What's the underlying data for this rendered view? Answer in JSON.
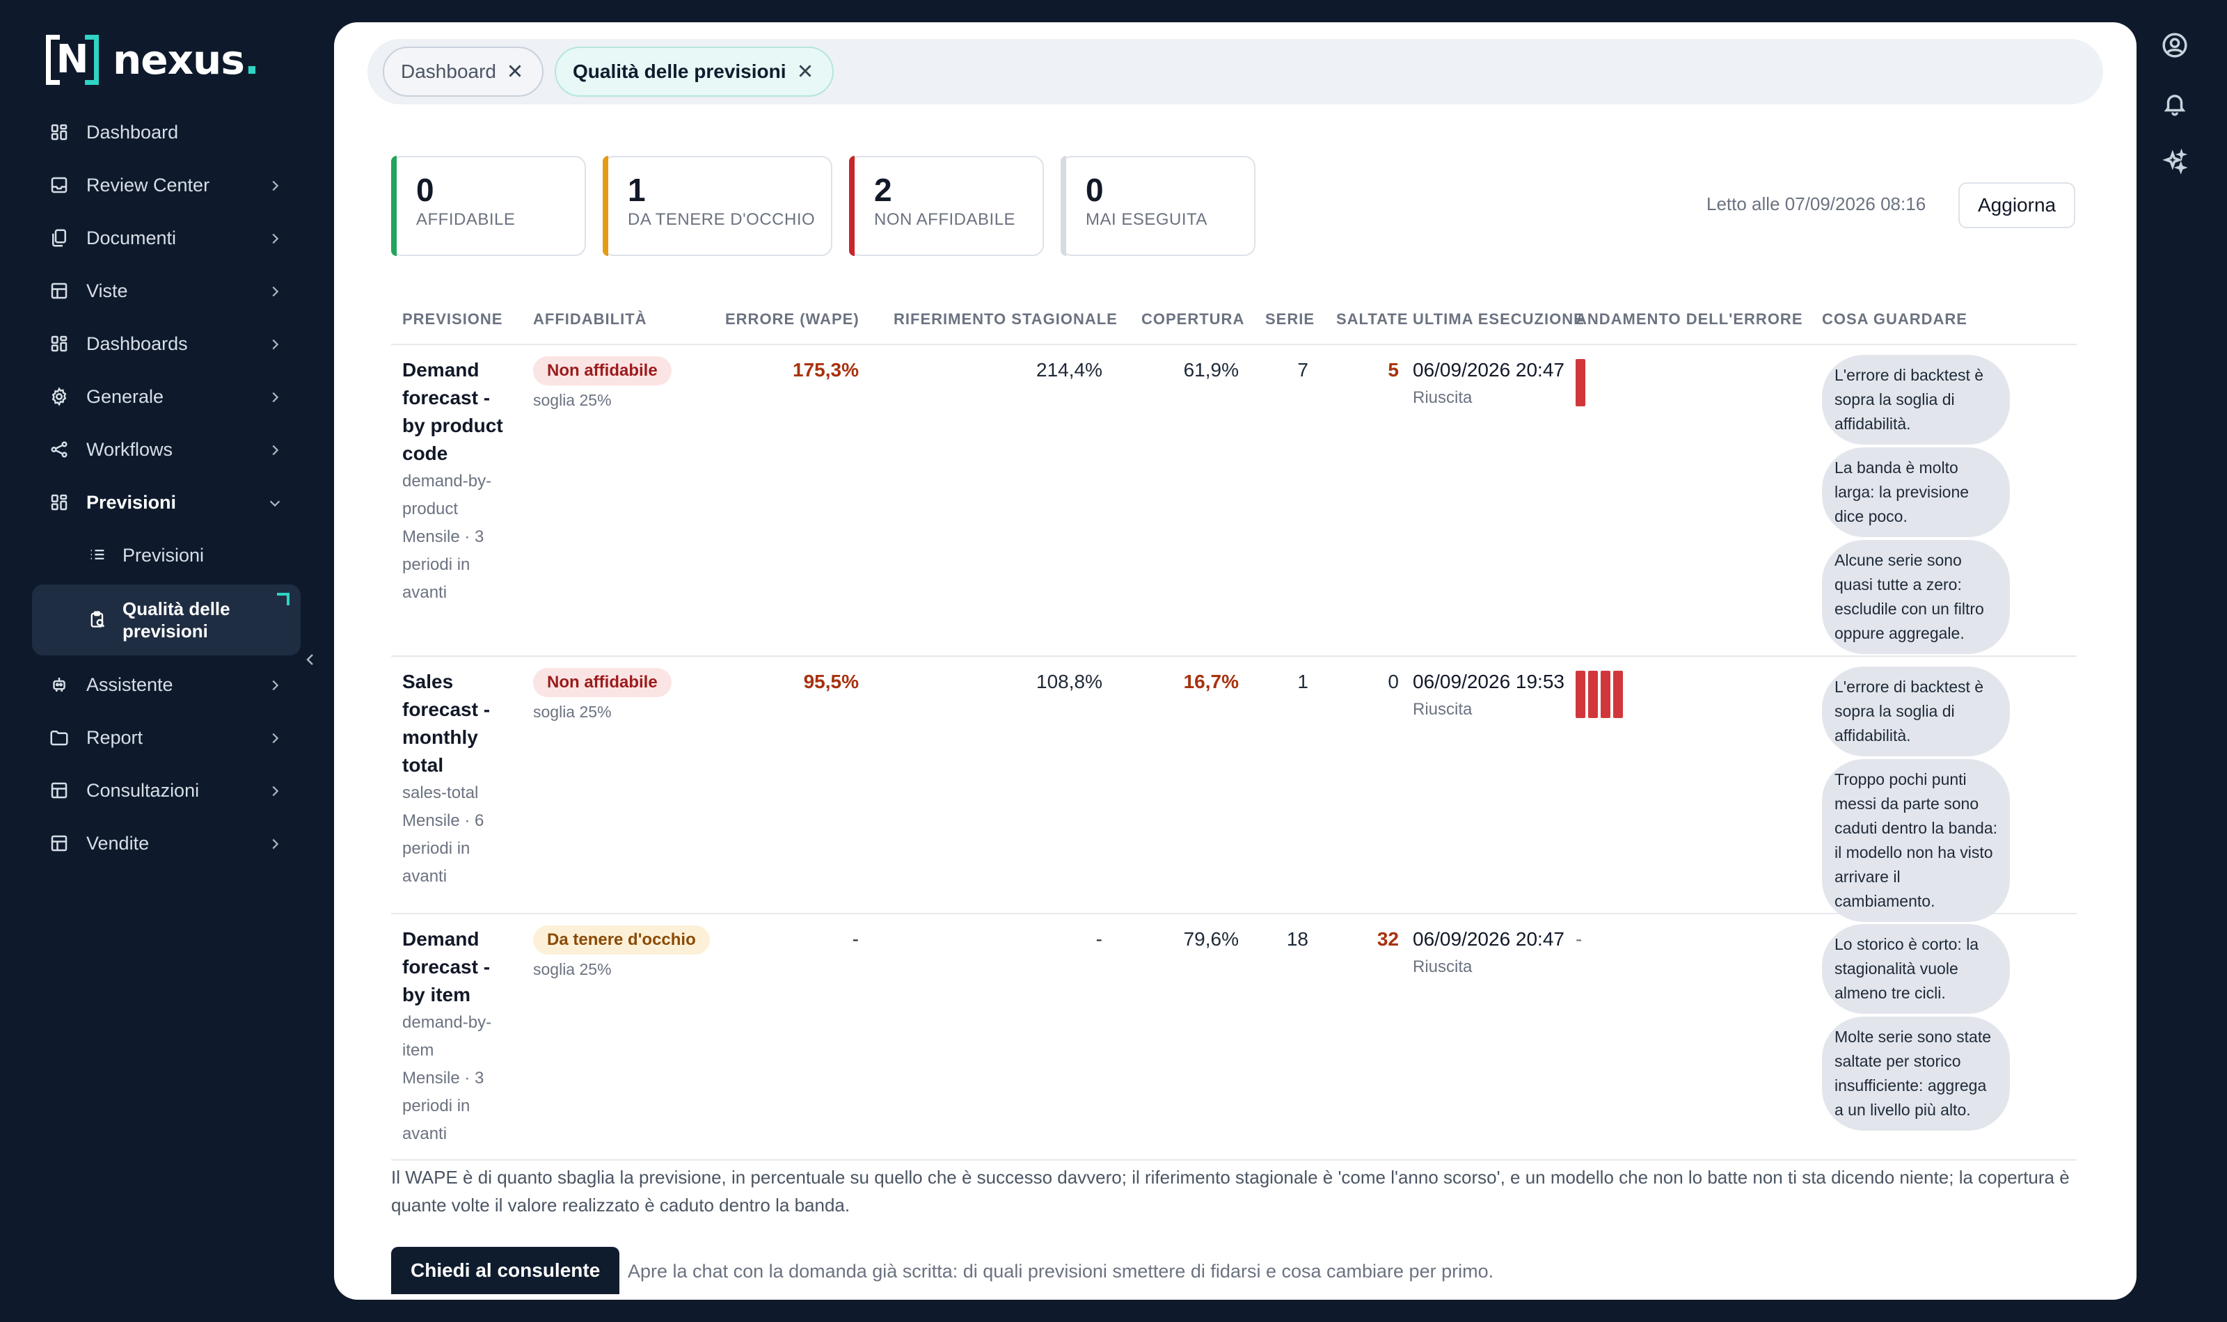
{
  "brand": {
    "name": "nexus",
    "dot": ".",
    "mark_letter": "N"
  },
  "nav": {
    "items": [
      {
        "label": "Dashboard",
        "icon": "grid-icon",
        "chevron": false
      },
      {
        "label": "Review Center",
        "icon": "inbox-icon",
        "chevron": true
      },
      {
        "label": "Documenti",
        "icon": "documents-icon",
        "chevron": true
      },
      {
        "label": "Viste",
        "icon": "table-icon",
        "chevron": true
      },
      {
        "label": "Dashboards",
        "icon": "grid-icon",
        "chevron": true
      },
      {
        "label": "Generale",
        "icon": "gear-icon",
        "chevron": true
      },
      {
        "label": "Workflows",
        "icon": "workflow-icon",
        "chevron": true
      },
      {
        "label": "Previsioni",
        "icon": "grid-icon",
        "chevron": true,
        "open": true
      }
    ],
    "sub_items": [
      {
        "label": "Previsioni",
        "icon": "list-icon"
      },
      {
        "label": "Qualità delle previsioni",
        "icon": "clipboard-icon",
        "active": true
      }
    ],
    "items_after": [
      {
        "label": "Assistente",
        "icon": "robot-icon"
      },
      {
        "label": "Report",
        "icon": "folder-icon"
      },
      {
        "label": "Consultazioni",
        "icon": "table-icon"
      },
      {
        "label": "Vendite",
        "icon": "table-icon"
      }
    ]
  },
  "rail": [
    "user-circle-icon",
    "bell-icon",
    "sparkles-icon"
  ],
  "tabs": [
    {
      "label": "Dashboard",
      "active": false
    },
    {
      "label": "Qualità delle previsioni",
      "active": true
    }
  ],
  "kpis": [
    {
      "value": "0",
      "label": "AFFIDABILE",
      "color": "#22a55b"
    },
    {
      "value": "1",
      "label": "DA TENERE D'OCCHIO",
      "color": "#e69b14"
    },
    {
      "value": "2",
      "label": "NON AFFIDABILE",
      "color": "#c8262b"
    },
    {
      "value": "0",
      "label": "MAI ESEGUITA",
      "color": "#d6dbe3"
    }
  ],
  "read_at": "Letto alle 07/09/2026 08:16",
  "refresh_label": "Aggiorna",
  "table": {
    "headers": [
      "PREVISIONE",
      "AFFIDABILITÀ",
      "ERRORE (WAPE)",
      "RIFERIMENTO STAGIONALE",
      "COPERTURA",
      "SERIE",
      "SALTATE",
      "ULTIMA ESECUZIONE",
      "ANDAMENTO DELL'ERRORE",
      "COSA GUARDARE"
    ],
    "rows": [
      {
        "name": "Demand forecast - by product code",
        "slug": "demand-by-product",
        "meta": "Mensile · 3 periodi in avanti",
        "badge": "Non affidabile",
        "badge_kind": "bad",
        "threshold": "soglia 25%",
        "wape": "175,3%",
        "seasonal": "214,4%",
        "coverage": "61,9%",
        "coverage_bad": false,
        "series": "7",
        "skipped": "5",
        "skipped_bad": true,
        "last_run": "06/09/2026 20:47",
        "run_status": "Riuscita",
        "trend_bars": 1,
        "trend_empty": "",
        "notes": [
          "L'errore di backtest è sopra la soglia di affidabilità.",
          "La banda è molto larga: la previsione dice poco.",
          "Alcune serie sono quasi tutte a zero: escludile con un filtro oppure aggregale."
        ]
      },
      {
        "name": "Sales forecast - monthly total",
        "slug": "sales-total",
        "meta": "Mensile · 6 periodi in avanti",
        "badge": "Non affidabile",
        "badge_kind": "bad",
        "threshold": "soglia 25%",
        "wape": "95,5%",
        "seasonal": "108,8%",
        "coverage": "16,7%",
        "coverage_bad": true,
        "series": "1",
        "skipped": "0",
        "skipped_bad": false,
        "last_run": "06/09/2026 19:53",
        "run_status": "Riuscita",
        "trend_bars": 4,
        "trend_empty": "",
        "notes": [
          "L'errore di backtest è sopra la soglia di affidabilità.",
          "Troppo pochi punti messi da parte sono caduti dentro la banda: il modello non ha visto arrivare il cambiamento."
        ]
      },
      {
        "name": "Demand forecast - by item",
        "slug": "demand-by-item",
        "meta": "Mensile · 3 periodi in avanti",
        "badge": "Da tenere d'occhio",
        "badge_kind": "warn",
        "threshold": "soglia 25%",
        "wape": "-",
        "seasonal": "-",
        "coverage": "79,6%",
        "coverage_bad": false,
        "series": "18",
        "skipped": "32",
        "skipped_bad": true,
        "last_run": "06/09/2026 20:47",
        "run_status": "Riuscita",
        "trend_bars": 0,
        "trend_empty": "-",
        "notes": [
          "Lo storico è corto: la stagionalità vuole almeno tre cicli.",
          "Molte serie sono state saltate per storico insufficiente: aggrega a un livello più alto."
        ]
      }
    ]
  },
  "footnote": "Il WAPE è di quanto sbaglia la previsione, in percentuale su quello che è successo davvero; il riferimento stagionale è 'come l'anno scorso', e un modello che non lo batte non ti sta dicendo niente; la copertura è quante volte il valore realizzato è caduto dentro la banda.",
  "ask_button": "Chiedi al consulente",
  "ask_desc": "Apre la chat con la domanda già scritta: di quali previsioni smettere di fidarsi e cosa cambiare per primo."
}
